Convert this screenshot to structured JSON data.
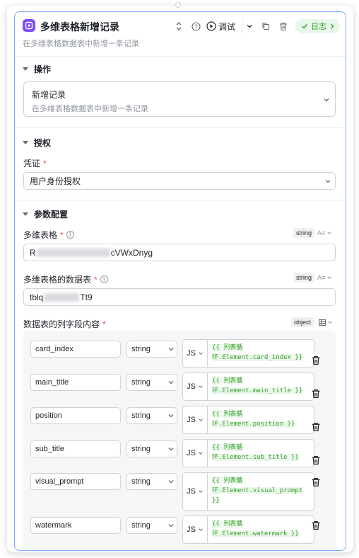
{
  "header": {
    "title": "多维表格新增记录",
    "subtitle": "在多维表格数据表中新增一条记录",
    "debug_label": "调试",
    "log_label": "日志"
  },
  "operation": {
    "section_title": "操作",
    "selected_title": "新增记录",
    "selected_desc": "在多维表格数据表中新增一条记录"
  },
  "auth": {
    "section_title": "授权",
    "credential_label": "凭证",
    "credential_value": "用户身份授权"
  },
  "params": {
    "section_title": "参数配置",
    "bitable": {
      "label": "多维表格",
      "type": "string",
      "value_prefix": "R",
      "value_suffix": "cVWxDnyg"
    },
    "table": {
      "label": "多维表格的数据表",
      "type": "string",
      "value_prefix": "tblq",
      "value_suffix": "Tt9"
    },
    "columns": {
      "label": "数据表的列字段内容",
      "type": "object"
    }
  },
  "fields": [
    {
      "name": "card_index",
      "type": "string",
      "mode": "JS",
      "code_line1": "{{ 列表循",
      "code_line2": "环.Element.card_index }}"
    },
    {
      "name": "main_title",
      "type": "string",
      "mode": "JS",
      "code_line1": "{{ 列表循",
      "code_line2": "环.Element.main_title }}"
    },
    {
      "name": "position",
      "type": "string",
      "mode": "JS",
      "code_line1": "{{ 列表循",
      "code_line2": "环.Element.position }}"
    },
    {
      "name": "sub_title",
      "type": "string",
      "mode": "JS",
      "code_line1": "{{ 列表循",
      "code_line2": "环.Element.sub_title }}"
    },
    {
      "name": "visual_prompt",
      "type": "string",
      "mode": "JS",
      "code_line1": "{{ 列表循",
      "code_line2": "环.Element.visual_prompt",
      "code_line3": "}}"
    },
    {
      "name": "watermark",
      "type": "string",
      "mode": "JS",
      "code_line1": "{{ 列表循",
      "code_line2": "环.Element.watermark }}"
    }
  ],
  "colors": {
    "accent": "#7c4dff",
    "panel_border": "#7aa7ff",
    "success": "#2ea121",
    "required": "#f54a45"
  }
}
